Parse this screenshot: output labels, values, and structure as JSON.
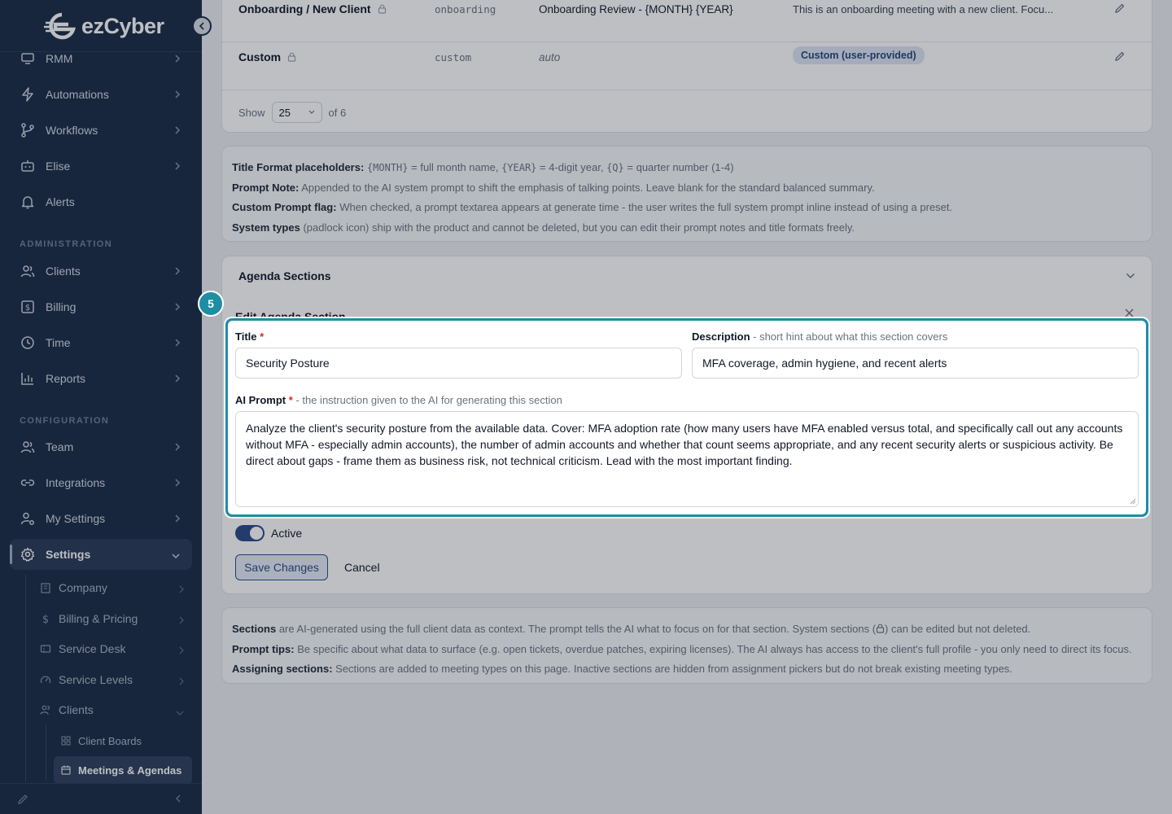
{
  "brand": {
    "name": "ezCyber"
  },
  "sidebar": {
    "items": [
      {
        "label": "RMM",
        "icon": "monitor-icon"
      },
      {
        "label": "Automations",
        "icon": "lightning-icon"
      },
      {
        "label": "Workflows",
        "icon": "branch-icon"
      },
      {
        "label": "Elise",
        "icon": "bot-icon"
      },
      {
        "label": "Alerts",
        "icon": "bell-icon"
      }
    ],
    "admin_label": "ADMINISTRATION",
    "admin_items": [
      {
        "label": "Clients",
        "icon": "users-icon"
      },
      {
        "label": "Billing",
        "icon": "dollar-icon"
      },
      {
        "label": "Time",
        "icon": "clock-icon"
      },
      {
        "label": "Reports",
        "icon": "chart-icon"
      }
    ],
    "config_label": "CONFIGURATION",
    "config_items": [
      {
        "label": "Team",
        "icon": "users-icon"
      },
      {
        "label": "Integrations",
        "icon": "link-icon"
      },
      {
        "label": "My Settings",
        "icon": "user-gear-icon"
      },
      {
        "label": "Settings",
        "icon": "gear-icon"
      }
    ],
    "settings_sub": [
      {
        "label": "Company"
      },
      {
        "label": "Billing & Pricing"
      },
      {
        "label": "Service Desk"
      },
      {
        "label": "Service Levels"
      },
      {
        "label": "Clients"
      }
    ],
    "clients_sub": [
      {
        "label": "Client Boards"
      },
      {
        "label": "Meetings & Agendas"
      }
    ]
  },
  "meeting_types": {
    "rows": [
      {
        "name": "Onboarding / New Client",
        "slug": "onboarding",
        "title_format": "Onboarding Review - {MONTH} {YEAR}",
        "description": "This is an onboarding meeting with a new client. Focu..."
      },
      {
        "name": "Custom",
        "slug": "custom",
        "title_format": "auto",
        "badge": "Custom (user-provided)"
      }
    ],
    "pager": {
      "show_label": "Show",
      "page_size": "25",
      "of_label": "of 6"
    }
  },
  "help_top": {
    "l1_key": "Title Format placeholders:",
    "l1_month": "{MONTH}",
    "l1_a": "= full month name,",
    "l1_year": "{YEAR}",
    "l1_b": "= 4-digit year,",
    "l1_q": "{Q}",
    "l1_c": "= quarter number (1-4)",
    "l2_key": "Prompt Note:",
    "l2_text": "Appended to the AI system prompt to shift the emphasis of talking points. Leave blank for the standard balanced summary.",
    "l3_key": "Custom Prompt flag:",
    "l3_text": "When checked, a prompt textarea appears at generate time - the user writes the full system prompt inline instead of using a preset.",
    "l4_key": "System types",
    "l4_text": "(padlock icon) ship with the product and cannot be deleted, but you can edit their prompt notes and title formats freely."
  },
  "agenda": {
    "header": "Agenda Sections",
    "edit_title": "Edit Agenda Section",
    "title_label": "Title",
    "title_value": "Security Posture",
    "desc_label": "Description",
    "desc_hint": "- short hint about what this section covers",
    "desc_value": "MFA coverage, admin hygiene, and recent alerts",
    "prompt_label": "AI Prompt",
    "prompt_hint": "- the instruction given to the AI for generating this section",
    "prompt_value": "Analyze the client's security posture from the available data. Cover: MFA adoption rate (how many users have MFA enabled versus total, and specifically call out any accounts without MFA - especially admin accounts), the number of admin accounts and whether that count seems appropriate, and any recent security alerts or suspicious activity. Be direct about gaps - frame them as business risk, not technical criticism. Lead with the most important finding.",
    "active_label": "Active",
    "save_label": "Save Changes",
    "cancel_label": "Cancel"
  },
  "help_bottom": {
    "l1_key": "Sections",
    "l1_text": "are AI-generated using the full client data as context. The prompt tells the AI what to focus on for that section. System sections (",
    "l1_text2": ") can be edited but not deleted.",
    "l2_key": "Prompt tips:",
    "l2_text": "Be specific about what data to surface (e.g. open tickets, overdue patches, expiring licenses). The AI always has access to the client's full profile - you only need to direct its focus.",
    "l3_key": "Assigning sections:",
    "l3_text": "Sections are added to meeting types on this page. Inactive sections are hidden from assignment pickers but do not break existing meeting types."
  },
  "tour": {
    "step": "5",
    "accent": "#1f8ea3"
  }
}
